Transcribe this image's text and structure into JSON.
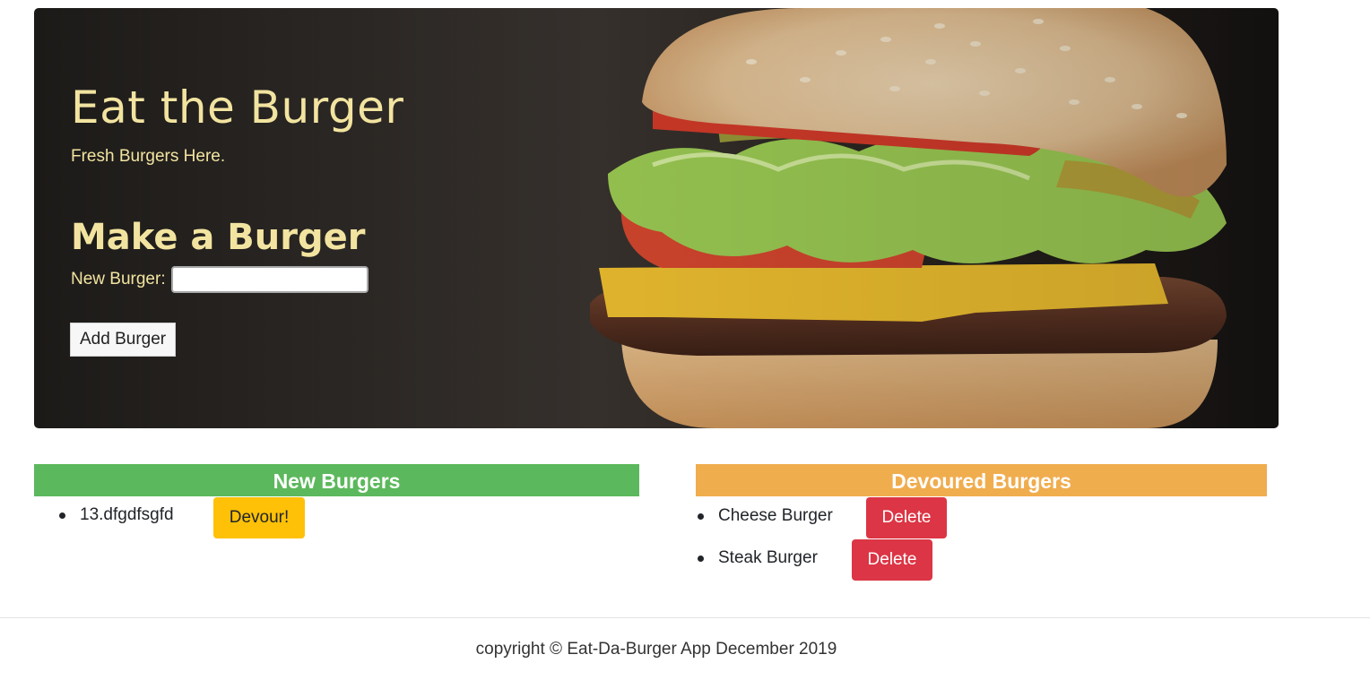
{
  "hero": {
    "title": "Eat the Burger",
    "subtitle": "Fresh Burgers Here.",
    "form_title": "Make a Burger",
    "input_label": "New Burger:",
    "input_value": "",
    "add_button": "Add Burger"
  },
  "new_burgers": {
    "header": "New Burgers",
    "items": [
      {
        "name": "13.dfgdfsgfd",
        "action": "Devour!"
      }
    ]
  },
  "devoured_burgers": {
    "header": "Devoured Burgers",
    "items": [
      {
        "name": "Cheese Burger",
        "action": "Delete"
      },
      {
        "name": "Steak Burger",
        "action": "Delete"
      }
    ]
  },
  "footer": {
    "text": "copyright © Eat-Da-Burger App December 2019"
  },
  "colors": {
    "hero_text": "#f2e4a0",
    "new_header": "#5cb85c",
    "devoured_header": "#f0ad4e",
    "devour_button": "#ffc107",
    "delete_button": "#dc3545"
  }
}
